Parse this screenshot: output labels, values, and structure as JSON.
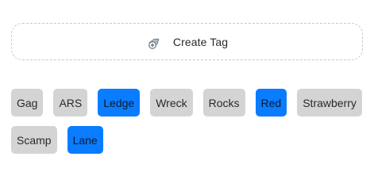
{
  "create_tag": {
    "label": "Create Tag",
    "icon": "add-tag-icon"
  },
  "tags": [
    {
      "label": "Gag",
      "selected": false
    },
    {
      "label": "ARS",
      "selected": false
    },
    {
      "label": "Ledge",
      "selected": true
    },
    {
      "label": "Wreck",
      "selected": false
    },
    {
      "label": "Rocks",
      "selected": false
    },
    {
      "label": "Red",
      "selected": true
    },
    {
      "label": "Strawberry",
      "selected": false
    },
    {
      "label": "Scamp",
      "selected": false
    },
    {
      "label": "Lane",
      "selected": true
    }
  ],
  "colors": {
    "tag_default": "#d4d4d4",
    "tag_selected": "#0a7cff",
    "border_dashed": "#c9c9c9"
  }
}
